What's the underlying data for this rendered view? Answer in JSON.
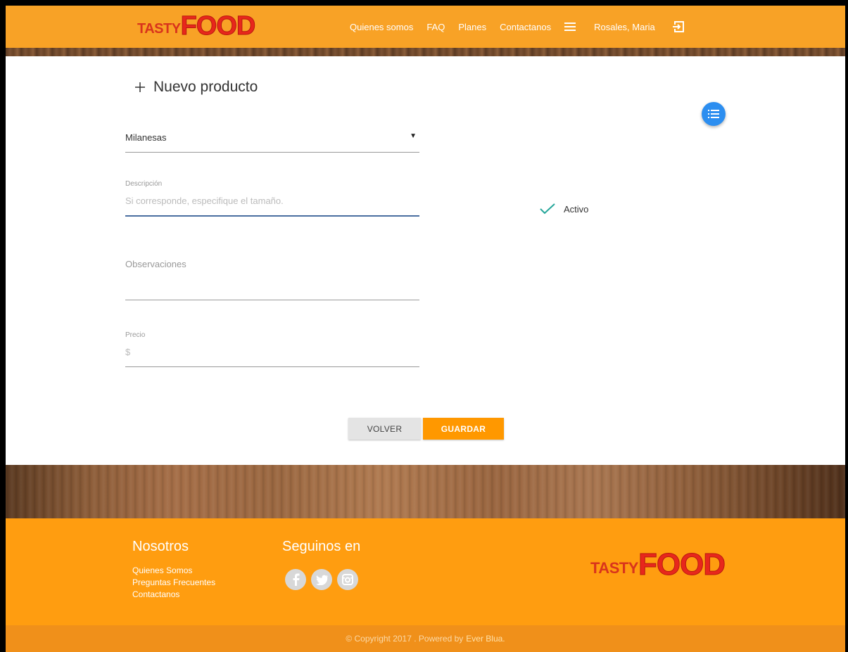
{
  "header": {
    "logo": {
      "tasty": "TASTY",
      "food": "FOOD"
    },
    "nav": [
      {
        "label": "Quienes somos"
      },
      {
        "label": "FAQ"
      },
      {
        "label": "Planes"
      },
      {
        "label": "Contactanos"
      }
    ],
    "menu_icon": "hamburger-icon",
    "user_name": "Rosales, Maria",
    "logout_icon": "logout-icon"
  },
  "main": {
    "title_icon": "plus",
    "title": "Nuevo producto",
    "list_button_icon": "list-icon",
    "category_select": {
      "value": "Milanesas"
    },
    "description": {
      "label": "Descripción",
      "placeholder": "Si corresponde, especifique el tamaño."
    },
    "observations": {
      "placeholder": "Observaciones"
    },
    "price": {
      "label": "Precio",
      "placeholder": "$"
    },
    "active_checkbox": {
      "label": "Activo",
      "checked": true
    },
    "buttons": {
      "back": "VOLVER",
      "save": "GUARDAR"
    }
  },
  "footer": {
    "nosotros_title": "Nosotros",
    "links": [
      "Quienes Somos",
      "Preguntas Frecuentes",
      "Contactanos"
    ],
    "follow_title": "Seguinos en",
    "social": [
      "facebook-icon",
      "twitter-icon",
      "instagram-icon"
    ],
    "logo": {
      "tasty": "TASTY",
      "food": "FOOD"
    },
    "copyright": "© Copyright 2017 . Powered by",
    "powered_brand": "Ever Blua."
  },
  "colors": {
    "header_bg": "#f8a226",
    "footer_bg": "#ff9d10",
    "accent_button": "#ff9800",
    "fab": "#2c8ef0",
    "check": "#26a69a"
  }
}
